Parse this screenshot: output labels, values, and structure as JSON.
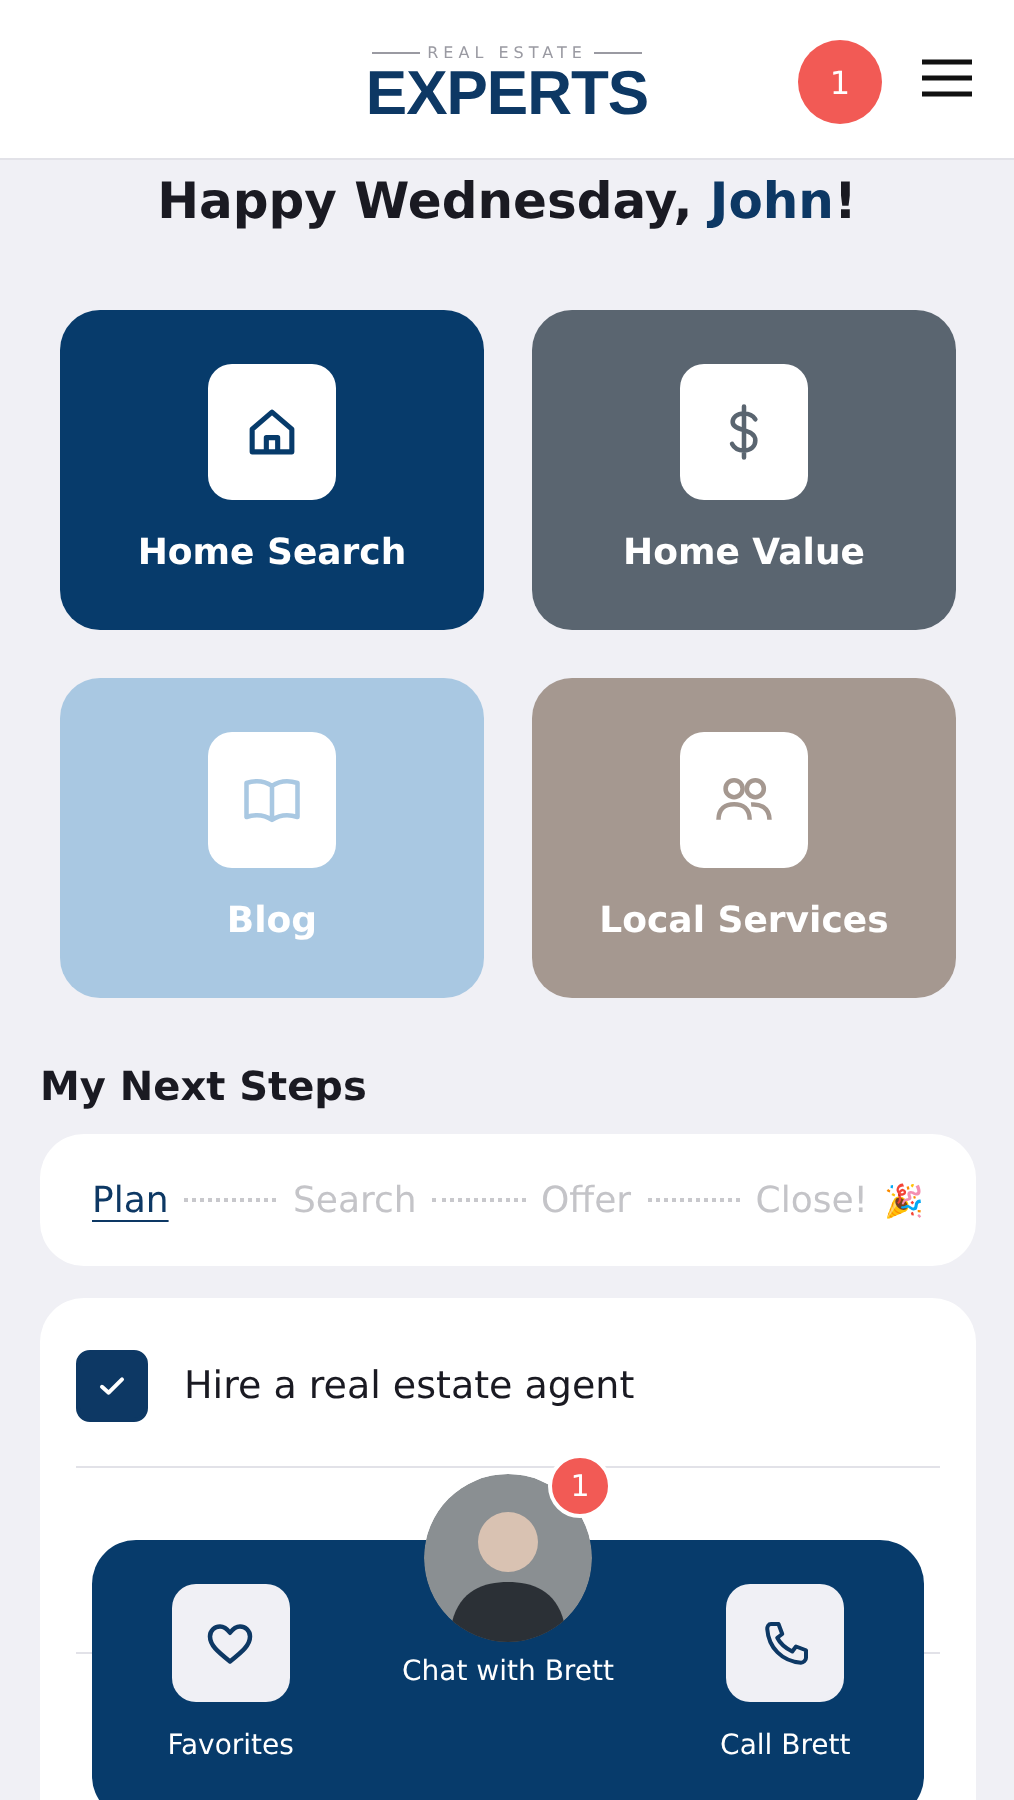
{
  "header": {
    "logo_tagline": "REAL ESTATE",
    "logo_name": "EXPERTS",
    "notification_count": "1"
  },
  "greeting": {
    "text": "Happy Wednesday, ",
    "name": "John",
    "suffix": "!"
  },
  "tiles": [
    {
      "label": "Home Search",
      "kind": "home",
      "color": "#073b6b"
    },
    {
      "label": "Home Value",
      "kind": "dollar",
      "color": "#5a6570"
    },
    {
      "label": "Blog",
      "kind": "book",
      "color": "#a9c8e2"
    },
    {
      "label": "Local Services",
      "kind": "people",
      "color": "#a59890"
    }
  ],
  "next_steps": {
    "title": "My Next Steps",
    "stages": [
      {
        "label": "Plan",
        "selected": true
      },
      {
        "label": "Search",
        "selected": false
      },
      {
        "label": "Offer",
        "selected": false
      },
      {
        "label": "Close!",
        "selected": false
      }
    ],
    "celebration": "🎉",
    "tasks": [
      {
        "label": "Hire a real estate agent",
        "checked": true
      }
    ]
  },
  "bottom_bar": {
    "items": [
      {
        "label": "Favorites",
        "kind": "heart"
      },
      {
        "label": "Chat with Brett",
        "kind": "avatar",
        "badge": "1"
      },
      {
        "label": "Call Brett",
        "kind": "phone"
      }
    ]
  }
}
